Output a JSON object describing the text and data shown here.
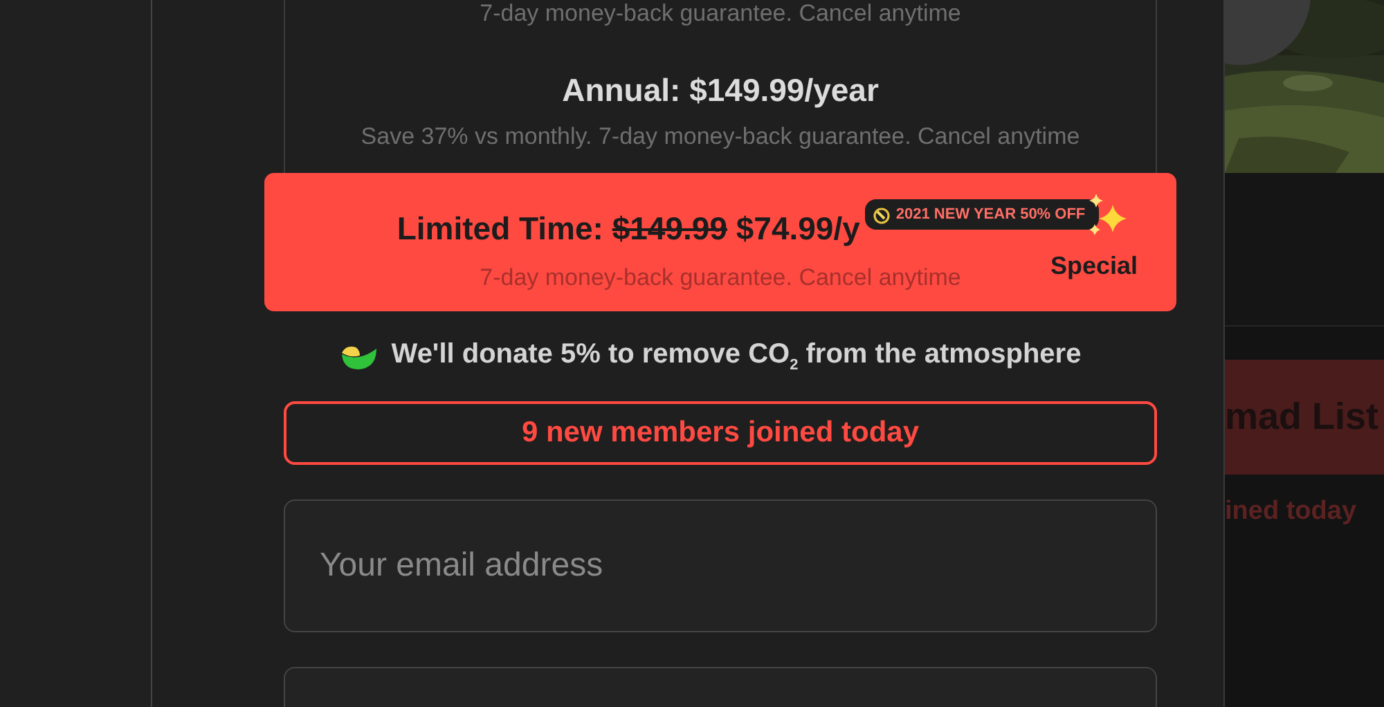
{
  "plans": [
    {
      "kind": "basic",
      "note": "7-day money-back guarantee. Cancel anytime",
      "selected": false
    },
    {
      "kind": "basic",
      "title": "Annual: $149.99/year",
      "note": "Save 37% vs monthly. 7-day money-back guarantee. Cancel anytime",
      "selected": false
    },
    {
      "kind": "promo",
      "label": "Limited Time:",
      "old_price": "$149.99",
      "price": "$74.99/y",
      "badge": "2021 NEW YEAR 50% OFF",
      "tag": "Special",
      "note": "7-day money-back guarantee. Cancel anytime",
      "selected": true
    }
  ],
  "donation": "We'll donate 5% to remove CO$_{2}$ from the atmosphere",
  "members_banner": "9 new members joined today",
  "email_field": {
    "placeholder": "Your email address"
  },
  "background_page": {
    "banner_title": "mad List",
    "banner_note": "ined today"
  }
}
